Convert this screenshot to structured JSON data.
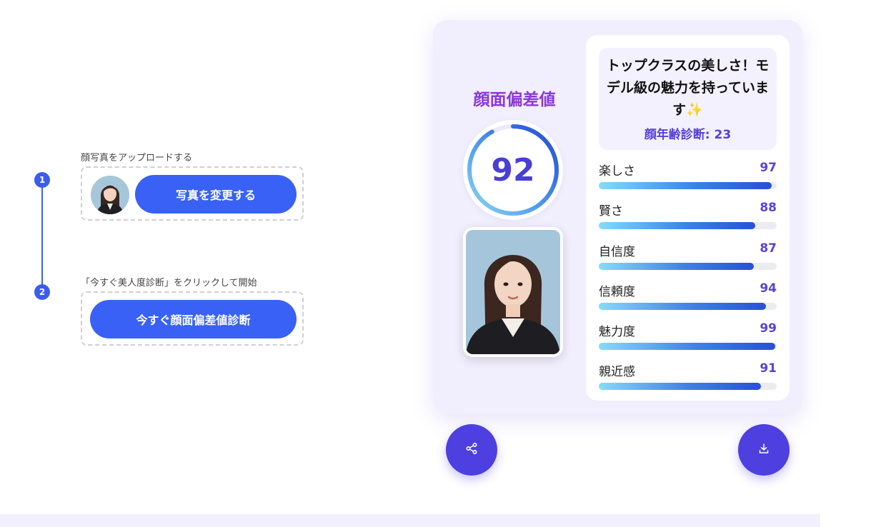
{
  "steps": [
    {
      "number": "1",
      "title": "顔写真をアップロードする",
      "button": "写真を変更する"
    },
    {
      "number": "2",
      "title": "「今すぐ美人度診断」をクリックして開始",
      "button": "今すぐ顔面偏差値診断"
    }
  ],
  "result": {
    "score_title": "顔面偏差値",
    "score": "92",
    "score_fraction": 0.92,
    "headline": "トップクラスの美しさ！モデル級の魅力を持っています✨",
    "age_label": "顔年齢診断: 23",
    "metrics": [
      {
        "label": "楽しさ",
        "value": "97",
        "percent": 97
      },
      {
        "label": "賢さ",
        "value": "88",
        "percent": 88
      },
      {
        "label": "自信度",
        "value": "87",
        "percent": 87
      },
      {
        "label": "信頼度",
        "value": "94",
        "percent": 94
      },
      {
        "label": "魅力度",
        "value": "99",
        "percent": 99
      },
      {
        "label": "親近感",
        "value": "91",
        "percent": 91
      }
    ]
  },
  "actions": {
    "share_icon": "share-icon",
    "download_icon": "download-icon"
  },
  "colors": {
    "primary": "#3961f5",
    "accent": "#4d3fe0",
    "score_title": "#8a38d6"
  }
}
